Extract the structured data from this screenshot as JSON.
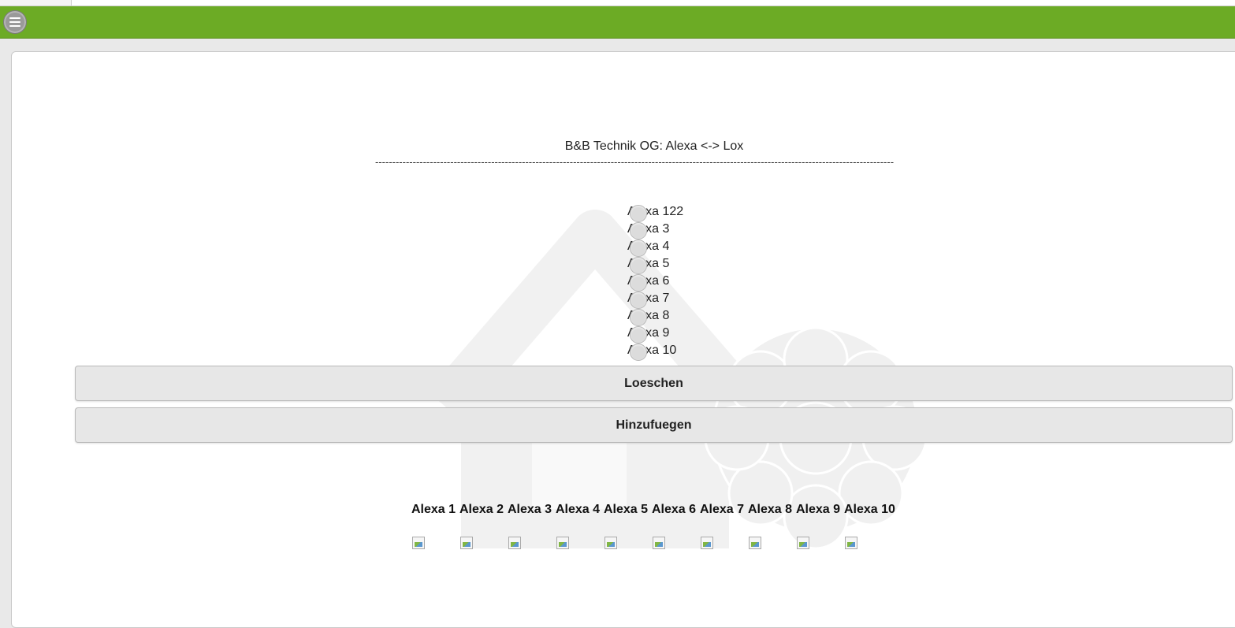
{
  "header": {
    "menu_icon": "hamburger-menu-icon",
    "bar_color": "#6cab25"
  },
  "main": {
    "title": "B&B Technik OG: Alexa <-> Lox",
    "divider": "--------------------------------------------------------------------------------------------------------------------------------------------------------",
    "radio_options": [
      "Alexa 122",
      "Alexa 3",
      "Alexa 4",
      "Alexa 5",
      "Alexa 6",
      "Alexa 7",
      "Alexa 8",
      "Alexa 9",
      "Alexa 10"
    ],
    "delete_label": "Loeschen",
    "add_label": "Hinzufuegen"
  },
  "alexa_columns": [
    {
      "label": "Alexa 1",
      "icon": "broken-image-icon"
    },
    {
      "label": "Alexa 2",
      "icon": "broken-image-icon"
    },
    {
      "label": "Alexa 3",
      "icon": "broken-image-icon"
    },
    {
      "label": "Alexa 4",
      "icon": "broken-image-icon"
    },
    {
      "label": "Alexa 5",
      "icon": "broken-image-icon"
    },
    {
      "label": "Alexa 6",
      "icon": "broken-image-icon"
    },
    {
      "label": "Alexa 7",
      "icon": "broken-image-icon"
    },
    {
      "label": "Alexa 8",
      "icon": "broken-image-icon"
    },
    {
      "label": "Alexa 9",
      "icon": "broken-image-icon"
    },
    {
      "label": "Alexa 10",
      "icon": "broken-image-icon"
    }
  ]
}
